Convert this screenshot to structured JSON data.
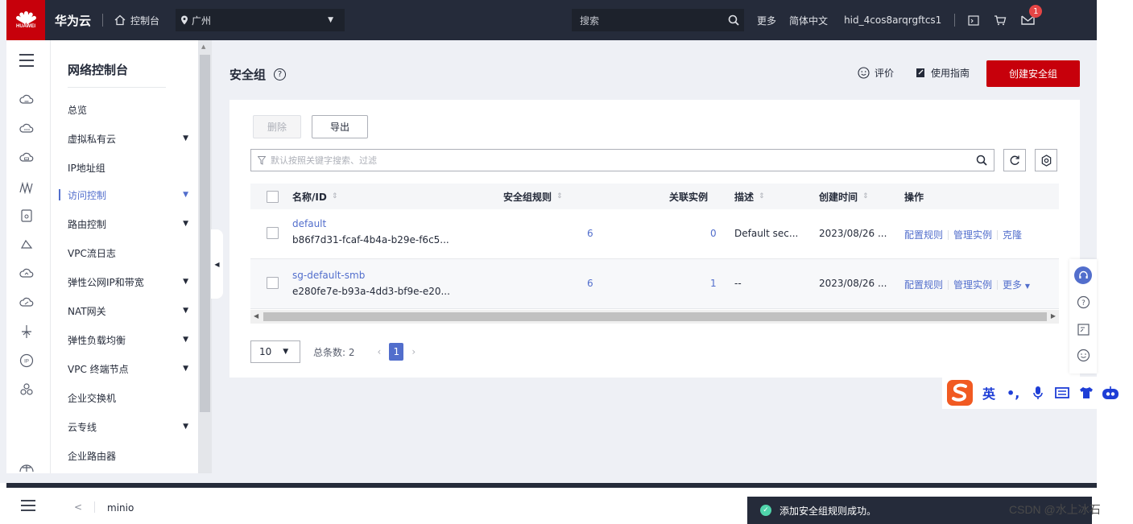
{
  "topbar": {
    "logo_text": "HUAWEI",
    "brand": "华为云",
    "console_label": "控制台",
    "region": "广州",
    "search_placeholder": "搜索",
    "more": "更多",
    "language": "简体中文",
    "username": "hid_4cos8arqrgftcs1",
    "message_badge": "1"
  },
  "sidebar": {
    "title": "网络控制台",
    "items": [
      {
        "label": "总览",
        "has_arrow": false
      },
      {
        "label": "虚拟私有云",
        "has_arrow": true
      },
      {
        "label": "IP地址组",
        "has_arrow": false
      },
      {
        "label": "访问控制",
        "has_arrow": true,
        "active": true
      },
      {
        "label": "路由控制",
        "has_arrow": true
      },
      {
        "label": "VPC流日志",
        "has_arrow": false
      },
      {
        "label": "弹性公网IP和带宽",
        "has_arrow": true
      },
      {
        "label": "NAT网关",
        "has_arrow": true
      },
      {
        "label": "弹性负载均衡",
        "has_arrow": true
      },
      {
        "label": "VPC 终端节点",
        "has_arrow": true
      },
      {
        "label": "企业交换机",
        "has_arrow": false
      },
      {
        "label": "云专线",
        "has_arrow": true
      },
      {
        "label": "企业路由器",
        "has_arrow": false
      }
    ]
  },
  "page": {
    "title": "安全组",
    "feedback": "评价",
    "guide": "使用指南",
    "create_button": "创建安全组"
  },
  "toolbar": {
    "delete_label": "删除",
    "export_label": "导出",
    "filter_placeholder": "默认按照关键字搜索、过滤"
  },
  "table": {
    "columns": [
      "名称/ID",
      "安全组规则",
      "关联实例",
      "描述",
      "创建时间",
      "操作"
    ],
    "rows": [
      {
        "name": "default",
        "id": "b86f7d31-fcaf-4b4a-b29e-f6c5...",
        "rules": "6",
        "instances": "0",
        "description": "Default sec...",
        "created": "2023/08/26 ...",
        "ops": [
          "配置规则",
          "管理实例",
          "克隆"
        ]
      },
      {
        "name": "sg-default-smb",
        "id": "e280fe7e-b93a-4dd3-bf9e-e20...",
        "rules": "6",
        "instances": "1",
        "description": "--",
        "created": "2023/08/26 ...",
        "ops": [
          "配置规则",
          "管理实例",
          "更多"
        ]
      }
    ]
  },
  "pagination": {
    "page_size": "10",
    "total_label": "总条数: 2",
    "current_page": "1"
  },
  "sogou": {
    "items": [
      "英",
      "•,"
    ]
  },
  "bottom": {
    "breadcrumb": "minio",
    "toast": "添加安全组规则成功。",
    "watermark": "CSDN @水上冰石"
  },
  "colors": {
    "brand_red": "#c7000b",
    "link_blue": "#526ecc",
    "topbar_bg": "#252b3a"
  }
}
